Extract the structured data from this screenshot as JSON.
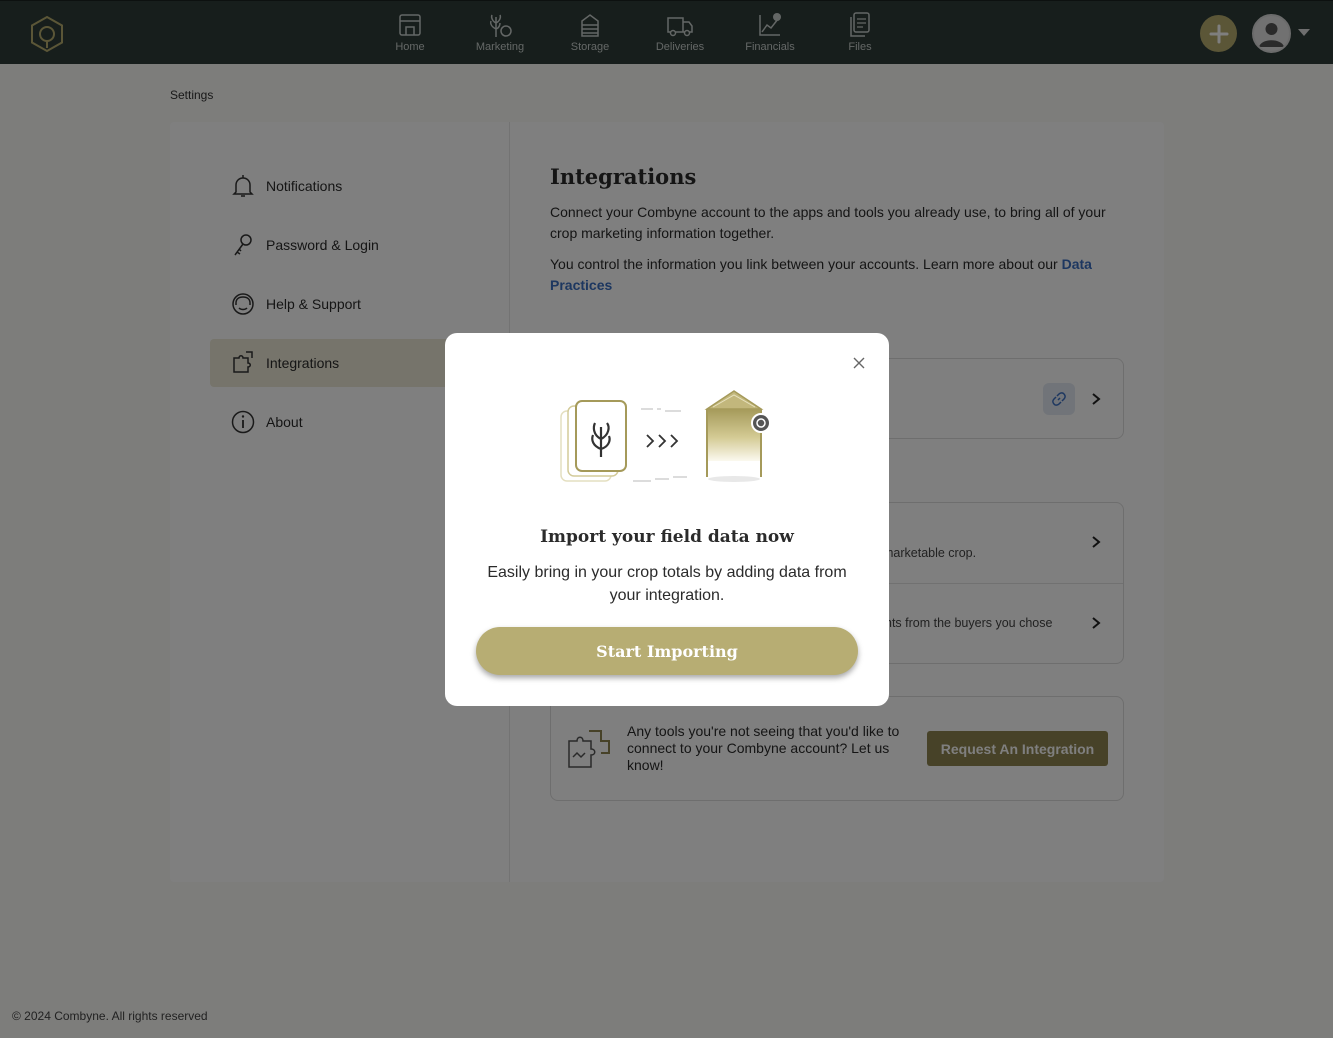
{
  "nav": {
    "items": [
      {
        "label": "Home",
        "icon": "storefront-icon"
      },
      {
        "label": "Marketing",
        "icon": "plant-icon"
      },
      {
        "label": "Storage",
        "icon": "silo-icon"
      },
      {
        "label": "Deliveries",
        "icon": "truck-icon"
      },
      {
        "label": "Financials",
        "icon": "chart-icon"
      },
      {
        "label": "Files",
        "icon": "files-icon"
      }
    ]
  },
  "breadcrumb": "Settings",
  "sidebar": {
    "items": [
      {
        "label": "Notifications",
        "icon": "bell-icon"
      },
      {
        "label": "Password & Login",
        "icon": "key-icon"
      },
      {
        "label": "Help & Support",
        "icon": "headset-icon"
      },
      {
        "label": "Integrations",
        "icon": "puzzle-icon",
        "active": true
      },
      {
        "label": "About",
        "icon": "info-icon"
      }
    ]
  },
  "content": {
    "title": "Integrations",
    "intro": "Connect your Combyne account to the apps and tools you already use, to bring all of your crop marketing information together.",
    "control_text": "You control the information you link between your accounts. Learn more about our ",
    "data_link": "Data Practices",
    "row2_fragment": "marketable crop.",
    "row3_fragment": "nts from the buyers you chose",
    "request_text": "Any tools you're not seeing that you'd like to connect to your Combyne account? Let us know!",
    "request_button": "Request An Integration"
  },
  "footer": "© 2024 Combyne. All rights reserved",
  "modal": {
    "title": "Import your field data now",
    "text": "Easily bring in your crop totals by adding data from your integration.",
    "button": "Start Importing"
  },
  "colors": {
    "nav_bg": "#2e3d39",
    "accent_gold": "#b7ad73",
    "button_dark_gold": "#8e8450",
    "link_blue": "#3a6ec0"
  }
}
